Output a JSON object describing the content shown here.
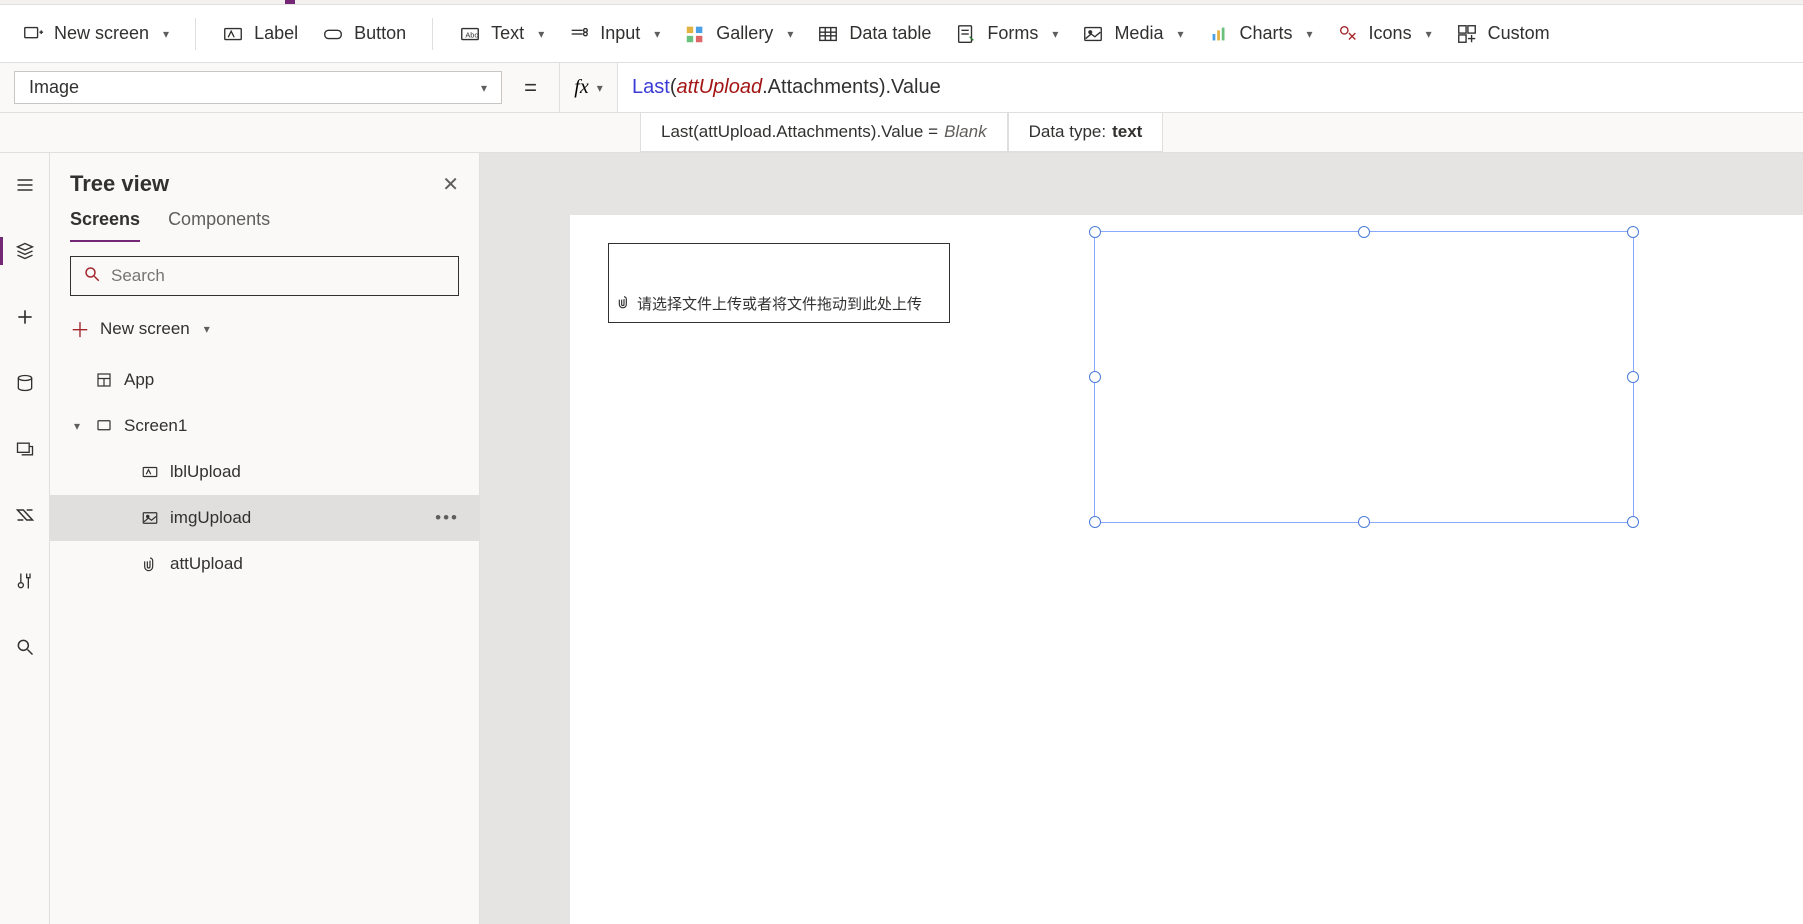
{
  "ribbon": {
    "new_screen": "New screen",
    "label": "Label",
    "button": "Button",
    "text": "Text",
    "input": "Input",
    "gallery": "Gallery",
    "data_table": "Data table",
    "forms": "Forms",
    "media": "Media",
    "charts": "Charts",
    "icons": "Icons",
    "custom": "Custom"
  },
  "property_selector": "Image",
  "formula": {
    "fn": "Last",
    "open": "(",
    "ident": "attUpload",
    "tail": ".Attachments).Value"
  },
  "result": {
    "expr": "Last(attUpload.Attachments).Value",
    "eq": "=",
    "value": "Blank",
    "datatype_label": "Data type:",
    "datatype_value": "text"
  },
  "tree": {
    "title": "Tree view",
    "tab_screens": "Screens",
    "tab_components": "Components",
    "search_placeholder": "Search",
    "new_screen": "New screen",
    "items": {
      "app": "App",
      "screen1": "Screen1",
      "lblUpload": "lblUpload",
      "imgUpload": "imgUpload",
      "attUpload": "attUpload"
    }
  },
  "canvas": {
    "attachment_hint": "请选择文件上传或者将文件拖动到此处上传"
  }
}
